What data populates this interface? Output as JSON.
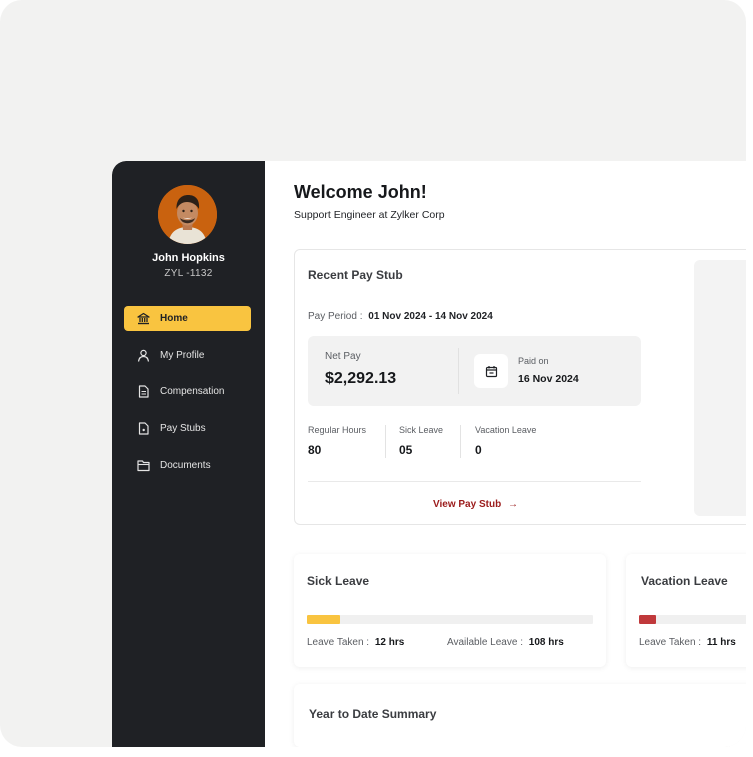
{
  "user": {
    "name": "John Hopkins",
    "id": "ZYL -1132"
  },
  "nav": [
    {
      "label": "Home",
      "icon": "bank-icon",
      "active": true
    },
    {
      "label": "My Profile",
      "icon": "person-icon"
    },
    {
      "label": "Compensation",
      "icon": "document-icon"
    },
    {
      "label": "Pay Stubs",
      "icon": "file-dollar-icon"
    },
    {
      "label": "Documents",
      "icon": "folder-icon"
    }
  ],
  "header": {
    "welcome": "Welcome John!",
    "subtitle": "Support Engineer at Zylker Corp"
  },
  "pay_stub": {
    "title": "Recent Pay Stub",
    "period_label": "Pay Period :",
    "period_value": "01 Nov 2024 - 14 Nov 2024",
    "net_pay_label": "Net Pay",
    "net_pay_value": "$2,292.13",
    "paid_on_label": "Paid on",
    "paid_on_value": "16 Nov 2024",
    "stats": [
      {
        "label": "Regular Hours",
        "value": "80"
      },
      {
        "label": "Sick Leave",
        "value": "05"
      },
      {
        "label": "Vacation Leave",
        "value": "0"
      }
    ],
    "view_link": "View Pay Stub"
  },
  "sick_leave": {
    "title": "Sick Leave",
    "taken_label": "Leave Taken :",
    "taken_value": "12 hrs",
    "available_label": "Available Leave :",
    "available_value": "108 hrs",
    "progress_fraction": 0.1,
    "color": "#f9c440"
  },
  "vacation_leave": {
    "title": "Vacation Leave",
    "taken_label": "Leave Taken :",
    "taken_value": "11 hrs",
    "color": "#c0393b"
  },
  "ytd": {
    "title": "Year to Date Summary"
  },
  "colors": {
    "sidebar": "#1f2125",
    "accent": "#f9c440",
    "link": "#9b1b1b"
  }
}
